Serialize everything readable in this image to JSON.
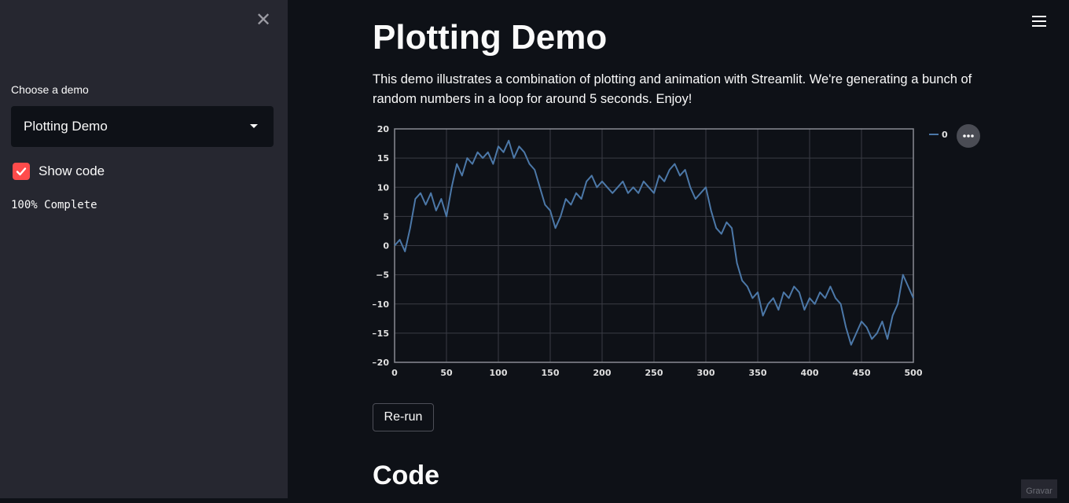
{
  "sidebar": {
    "close_icon": "close-icon",
    "choose_label": "Choose a demo",
    "select_value": "Plotting Demo",
    "show_code_label": "Show code",
    "show_code_checked": true,
    "progress_text": "100% Complete"
  },
  "header": {
    "menu_icon": "hamburger-menu-icon"
  },
  "main": {
    "title": "Plotting Demo",
    "description": "This demo illustrates a combination of plotting and animation with Streamlit. We're generating a bunch of random numbers in a loop for around 5 seconds. Enjoy!",
    "rerun_label": "Re-run",
    "code_heading": "Code"
  },
  "badge_text": "Gravar",
  "colors": {
    "accent": "#ff4b4b",
    "line": "#4c78a8",
    "background": "#0e1117",
    "sidebar": "#262730"
  },
  "chart_data": {
    "type": "line",
    "title": "",
    "xlabel": "",
    "ylabel": "",
    "xlim": [
      0,
      500
    ],
    "ylim": [
      -20,
      20
    ],
    "xticks": [
      0,
      50,
      100,
      150,
      200,
      250,
      300,
      350,
      400,
      450,
      500
    ],
    "yticks": [
      -20,
      -15,
      -10,
      -5,
      0,
      5,
      10,
      15,
      20
    ],
    "grid": true,
    "legend": "top-right",
    "series": [
      {
        "name": "0",
        "x": [
          0,
          5,
          10,
          15,
          20,
          25,
          30,
          35,
          40,
          45,
          50,
          55,
          60,
          65,
          70,
          75,
          80,
          85,
          90,
          95,
          100,
          105,
          110,
          115,
          120,
          125,
          130,
          135,
          140,
          145,
          150,
          155,
          160,
          165,
          170,
          175,
          180,
          185,
          190,
          195,
          200,
          205,
          210,
          215,
          220,
          225,
          230,
          235,
          240,
          245,
          250,
          255,
          260,
          265,
          270,
          275,
          280,
          285,
          290,
          295,
          300,
          305,
          310,
          315,
          320,
          325,
          330,
          335,
          340,
          345,
          350,
          355,
          360,
          365,
          370,
          375,
          380,
          385,
          390,
          395,
          400,
          405,
          410,
          415,
          420,
          425,
          430,
          435,
          440,
          445,
          450,
          455,
          460,
          465,
          470,
          475,
          480,
          485,
          490,
          495,
          500
        ],
        "values": [
          0,
          1,
          -1,
          3,
          8,
          9,
          7,
          9,
          6,
          8,
          5,
          10,
          14,
          12,
          15,
          14,
          16,
          15,
          16,
          14,
          17,
          16,
          18,
          15,
          17,
          16,
          14,
          13,
          10,
          7,
          6,
          3,
          5,
          8,
          7,
          9,
          8,
          11,
          12,
          10,
          11,
          10,
          9,
          10,
          11,
          9,
          10,
          9,
          11,
          10,
          9,
          12,
          11,
          13,
          14,
          12,
          13,
          10,
          8,
          9,
          10,
          6,
          3,
          2,
          4,
          3,
          -3,
          -6,
          -7,
          -9,
          -8,
          -12,
          -10,
          -9,
          -11,
          -8,
          -9,
          -7,
          -8,
          -11,
          -9,
          -10,
          -8,
          -9,
          -7,
          -9,
          -10,
          -14,
          -17,
          -15,
          -13,
          -14,
          -16,
          -15,
          -13,
          -16,
          -12,
          -10,
          -5,
          -7,
          -9
        ]
      }
    ]
  }
}
